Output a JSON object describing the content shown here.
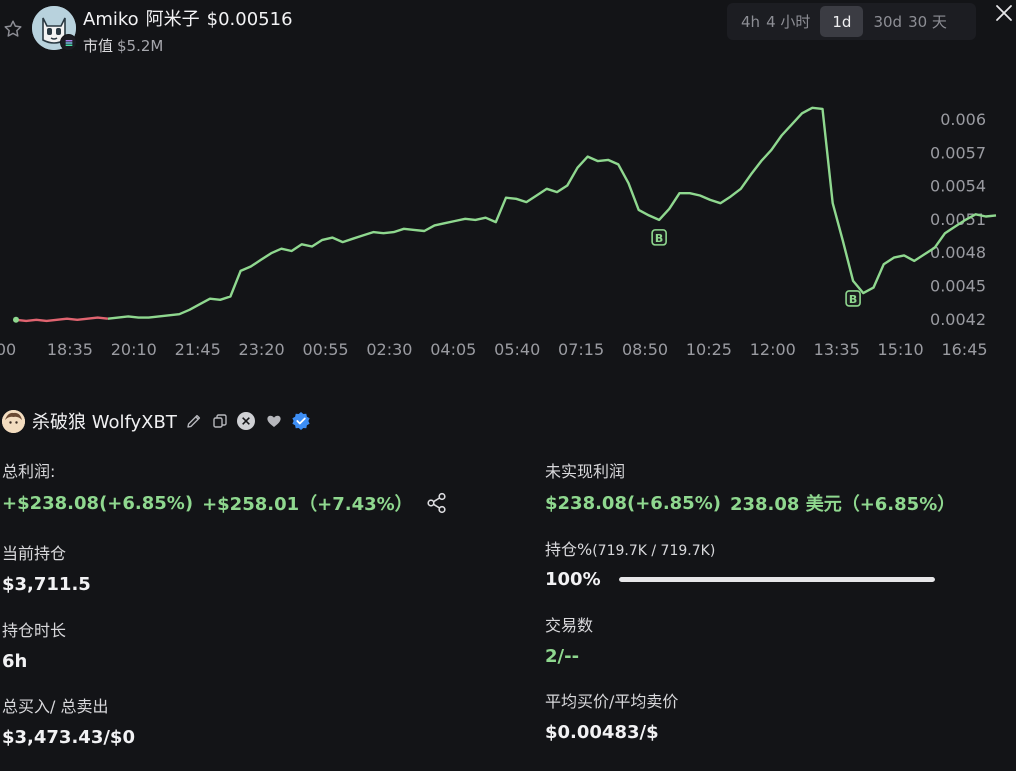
{
  "header": {
    "token_name": "Amiko",
    "token_cn_name": "阿米子",
    "price": "$0.00516",
    "mcap_label": "市值",
    "mcap_value": "$5.2M",
    "timeframes": [
      {
        "en": "4h",
        "cn": "4 小时",
        "active": false
      },
      {
        "en": "1d",
        "cn": "",
        "active": true
      },
      {
        "en": "30d",
        "cn": "30 天",
        "active": false
      }
    ]
  },
  "chart_data": {
    "type": "line",
    "x_labels": [
      "00",
      "18:35",
      "20:10",
      "21:45",
      "23:20",
      "00:55",
      "02:30",
      "04:05",
      "05:40",
      "07:15",
      "08:50",
      "10:25",
      "12:00",
      "13:35",
      "15:10",
      "16:45"
    ],
    "y_ticks": [
      "0.006",
      "0.0057",
      "0.0054",
      "0.0051",
      "0.0048",
      "0.0045",
      "0.0042"
    ],
    "y_tick_values": [
      0.006,
      0.0057,
      0.0054,
      0.0051,
      0.0048,
      0.0045,
      0.0042
    ],
    "ylim": [
      0.00418,
      0.00618
    ],
    "series": [
      {
        "color": "#8fd88f",
        "values": [
          0.0042,
          0.00419,
          0.0042,
          0.00419,
          0.0042,
          0.00421,
          0.0042,
          0.00421,
          0.00422,
          0.00421,
          0.00422,
          0.00423,
          0.00422,
          0.00422,
          0.00423,
          0.00424,
          0.00425,
          0.00429,
          0.00434,
          0.00439,
          0.00438,
          0.00441,
          0.00464,
          0.00468,
          0.00474,
          0.0048,
          0.00484,
          0.00482,
          0.00488,
          0.00486,
          0.00492,
          0.00494,
          0.0049,
          0.00493,
          0.00496,
          0.00499,
          0.00498,
          0.00499,
          0.00502,
          0.00501,
          0.005,
          0.00505,
          0.00507,
          0.00509,
          0.00511,
          0.0051,
          0.00512,
          0.00508,
          0.0053,
          0.00529,
          0.00526,
          0.00532,
          0.00538,
          0.00535,
          0.00541,
          0.00557,
          0.00567,
          0.00563,
          0.00564,
          0.0056,
          0.00543,
          0.00519,
          0.00514,
          0.0051,
          0.0052,
          0.00534,
          0.00534,
          0.00532,
          0.00528,
          0.00525,
          0.00531,
          0.00538,
          0.00551,
          0.00563,
          0.00573,
          0.00586,
          0.00596,
          0.00606,
          0.00611,
          0.0061,
          0.00525,
          0.00491,
          0.00455,
          0.00444,
          0.00449,
          0.0047,
          0.00476,
          0.00478,
          0.00473,
          0.00479,
          0.00485,
          0.00498,
          0.00504,
          0.0051,
          0.00515,
          0.00513,
          0.00514
        ]
      }
    ],
    "buy_markers": [
      {
        "index": 63,
        "value": 0.0051,
        "label": "B"
      },
      {
        "index": 82,
        "value": 0.00455,
        "label": "B"
      }
    ],
    "red_segment_end_index": 9,
    "red_color": "#e06470"
  },
  "trader": {
    "name": "杀破狼 WolfyXBT"
  },
  "stats": {
    "total_pnl": {
      "label": "总利润:",
      "value1": "+$238.08(+6.85%)",
      "value2": "+$258.01（+7.43%）"
    },
    "unrealized": {
      "label": "未实现利润",
      "value1": "$238.08(+6.85%)",
      "value2": "238.08 美元（+6.85%）"
    },
    "position": {
      "label": "当前持仓",
      "value": "$3,711.5"
    },
    "holding_pct": {
      "label": "持仓%",
      "detail": "(719.7K / 719.7K)",
      "value": "100%",
      "fraction": 1.0
    },
    "duration": {
      "label": "持仓时长",
      "value": "6h"
    },
    "trades": {
      "label": "交易数",
      "value": "2/--"
    },
    "buy_sell": {
      "label": "总买入/ 总卖出",
      "value": "$3,473.43/$0"
    },
    "avg_price": {
      "label": "平均买价/平均卖价",
      "value": "$0.00483/$"
    }
  }
}
